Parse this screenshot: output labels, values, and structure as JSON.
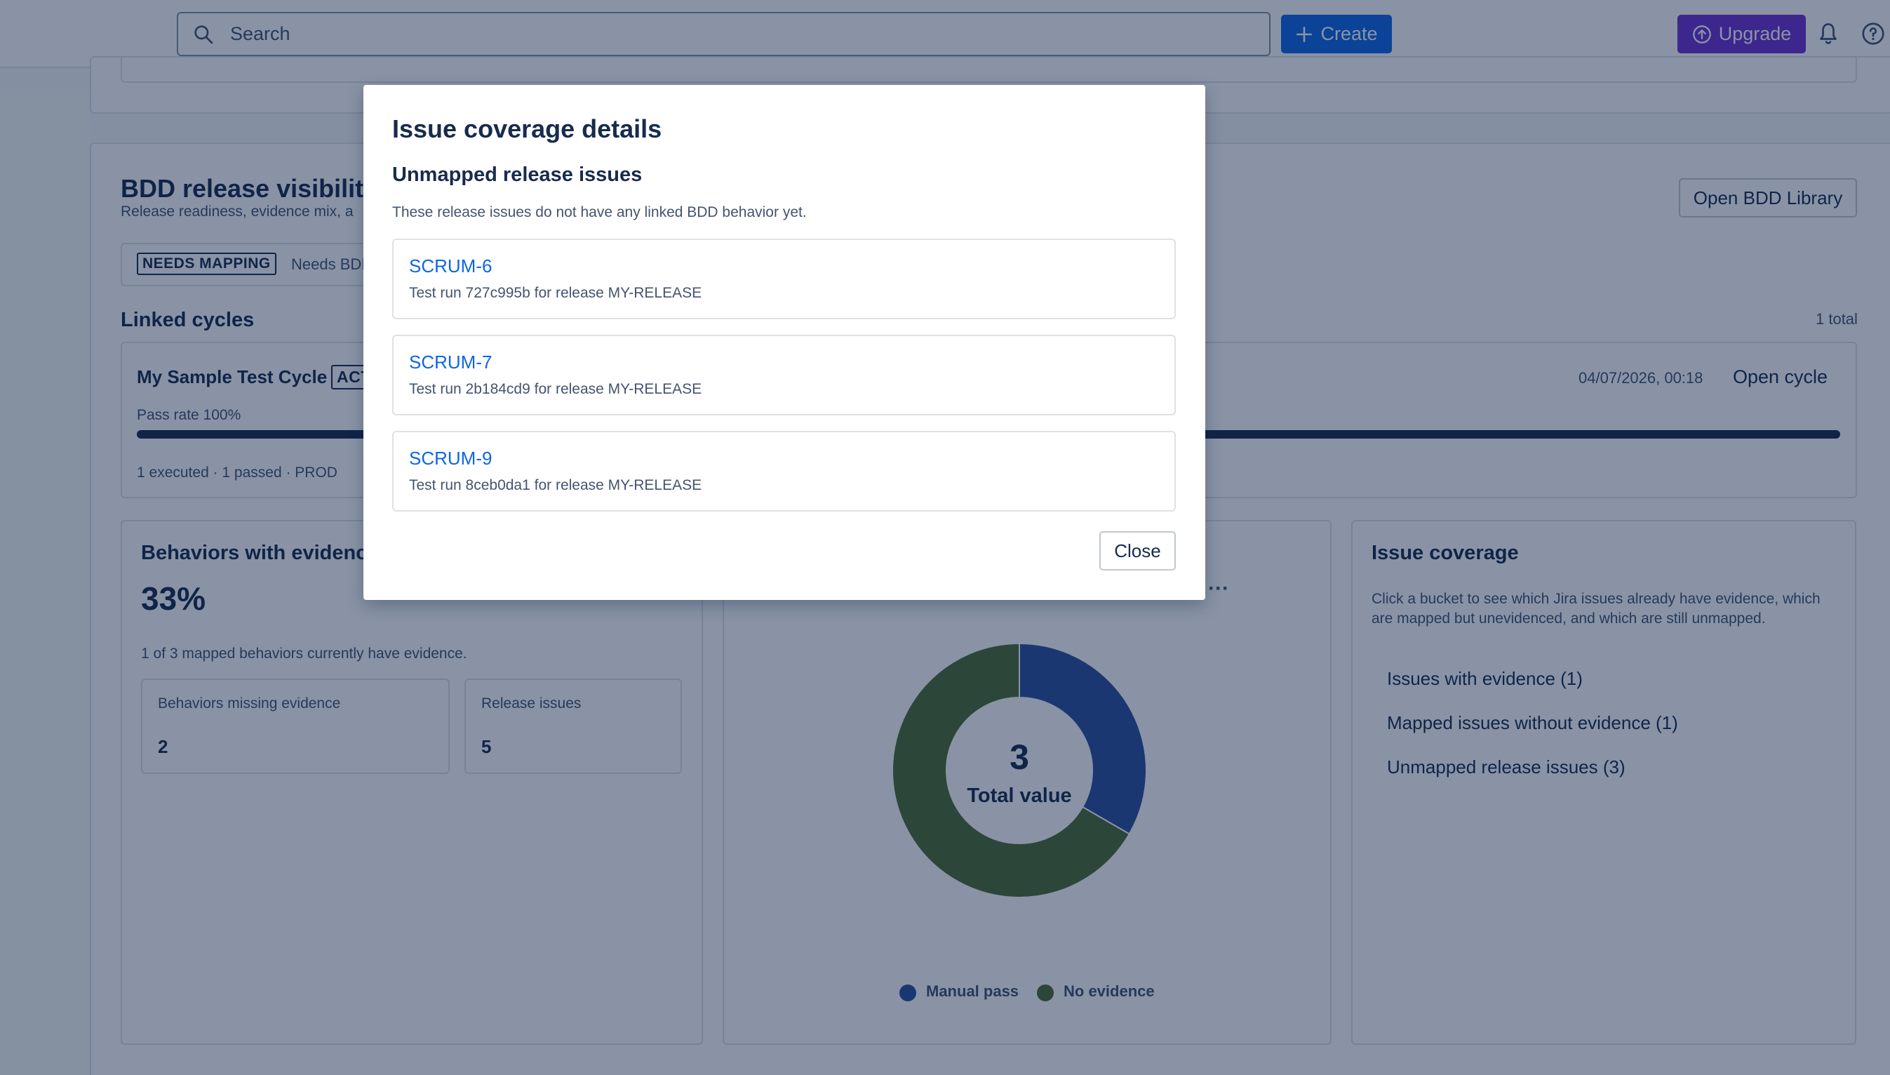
{
  "topbar": {
    "search_placeholder": "Search",
    "create_label": "Create",
    "upgrade_label": "Upgrade",
    "icons": [
      "search-icon",
      "plus-icon",
      "upgrade-icon",
      "bell-icon",
      "help-icon"
    ]
  },
  "release": {
    "title": "BDD release visibility",
    "subtitle": "Release readiness, evidence mix, a",
    "open_library_label": "Open BDD Library",
    "status_lozenge": "NEEDS MAPPING",
    "status_text": "Needs BDI"
  },
  "cycles": {
    "heading": "Linked cycles",
    "total": "1 total",
    "cycle_name": "My Sample Test Cycle",
    "cycle_badge": "ACT",
    "timestamp": "04/07/2026, 00:18",
    "open_label": "Open cycle",
    "pass_rate": "Pass rate 100%",
    "pass_rate_value": 1.0,
    "summary": "1 executed · 1 passed · PROD"
  },
  "behaviors": {
    "title": "Behaviors with evidenc",
    "percent": "33%",
    "description": "1 of 3 mapped behaviors currently have evidence.",
    "missing_label": "Behaviors missing evidence",
    "missing_value": "2",
    "issues_label": "Release issues",
    "issues_value": "5"
  },
  "chart_data": {
    "type": "pie",
    "center_value": "3",
    "center_label": "Total value",
    "categories": [
      "Manual pass",
      "No evidence"
    ],
    "values": [
      1,
      2
    ],
    "colors": [
      "#2c4f9e",
      "#4e6b33"
    ],
    "legend_position": "bottom",
    "more_label": "···"
  },
  "coverage": {
    "title": "Issue coverage",
    "description": "Click a bucket to see which Jira issues already have evidence, which are mapped but unevidenced, and which are still unmapped.",
    "buckets": [
      "Issues with evidence (1)",
      "Mapped issues without evidence (1)",
      "Unmapped release issues (3)"
    ]
  },
  "modal": {
    "title": "Issue coverage details",
    "subtitle": "Unmapped release issues",
    "description": "These release issues do not have any linked BDD behavior yet.",
    "issues": [
      {
        "key": "SCRUM-6",
        "summary": "Test run 727c995b for release MY-RELEASE"
      },
      {
        "key": "SCRUM-7",
        "summary": "Test run 2b184cd9 for release MY-RELEASE"
      },
      {
        "key": "SCRUM-9",
        "summary": "Test run 8ceb0da1 for release MY-RELEASE"
      }
    ],
    "close_label": "Close"
  }
}
